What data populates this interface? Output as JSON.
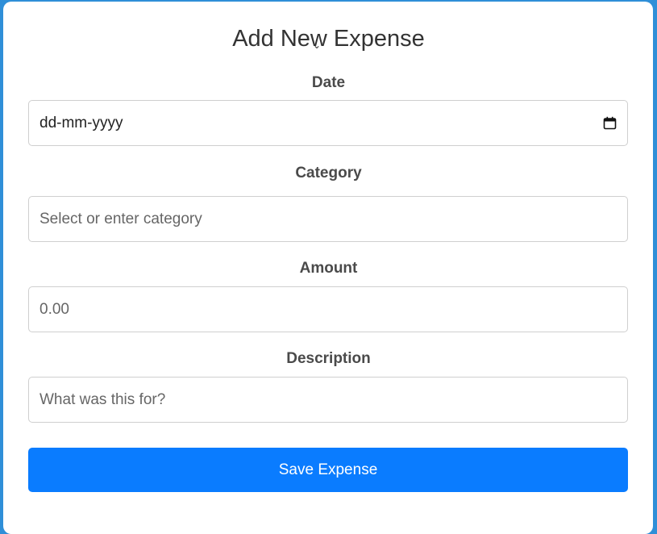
{
  "form": {
    "title": "Add New Expense",
    "date": {
      "label": "Date",
      "value": "dd-mm-yyyy"
    },
    "category": {
      "label": "Category",
      "placeholder": "Select or enter category"
    },
    "amount": {
      "label": "Amount",
      "placeholder": "0.00"
    },
    "description": {
      "label": "Description",
      "placeholder": "What was this for?"
    },
    "save_label": "Save Expense"
  },
  "colors": {
    "accent": "#0a7cff",
    "frame": "#2f8fd8"
  },
  "icons": {
    "date": "calendar-icon"
  }
}
